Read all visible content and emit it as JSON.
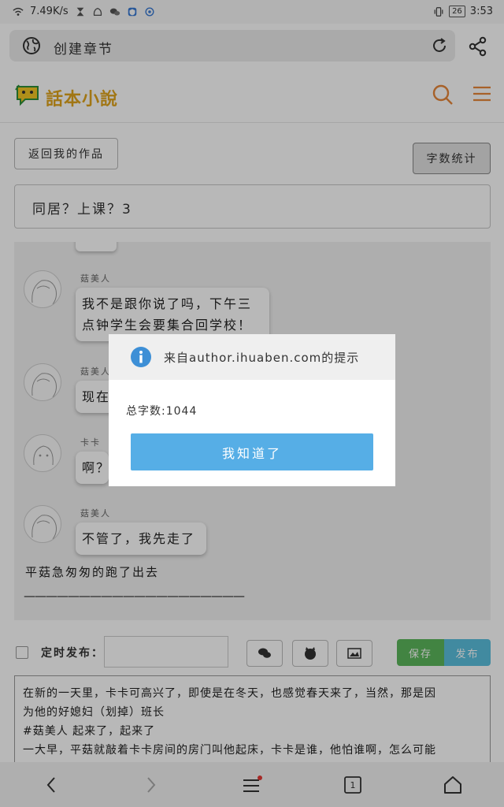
{
  "status_bar": {
    "speed": "7.49K/s",
    "battery": "26",
    "time": "3:53"
  },
  "browser": {
    "address_text": "创建章节"
  },
  "site": {
    "logo_text": "話本小說"
  },
  "toolbar": {
    "back_label": "返回我的作品",
    "count_label": "字数统计"
  },
  "chapter": {
    "title": "同居？上课？3"
  },
  "preview": {
    "messages": [
      {
        "name": "菇美人",
        "lines": [
          "我不是跟你说了吗，下午三",
          "点钟学生会要集合回学校！"
        ]
      },
      {
        "name": "菇美人",
        "lines": [
          "现在"
        ]
      },
      {
        "name": "卡卡",
        "lines": [
          "啊？"
        ]
      },
      {
        "name": "菇美人",
        "lines": [
          "不管了，我先走了"
        ]
      }
    ],
    "narration": "平菇急匆匆的跑了出去",
    "dashes": "————————————————————"
  },
  "publish": {
    "schedule_label": "定时发布：",
    "save_label": "保存",
    "publish_label": "发布"
  },
  "editor": {
    "lines": [
      "在新的一天里，卡卡可高兴了，即使是在冬天，也感觉春天来了，当然，那是因",
      "为他的好媳妇（划掉）班长",
      "#菇美人 起来了，起来了",
      "一大早，平菇就敲着卡卡房间的房门叫他起床，卡卡是谁，他怕谁啊，怎么可能"
    ]
  },
  "dialog": {
    "title": "来自author.ihuaben.com的提示",
    "body": "总字数:1044",
    "ok_label": "我知道了"
  },
  "colors": {
    "accent_orange": "#e8873a",
    "save_green": "#5cb85c",
    "publish_blue": "#5bc0de",
    "dialog_button": "#56aee6",
    "info_icon": "#3d8fd6"
  },
  "icons": {
    "status_left": [
      "wifi-icon",
      "hourglass-icon",
      "app-icon",
      "wechat-icon",
      "shield-icon",
      "browser-icon"
    ],
    "status_right": [
      "vibrate-icon",
      "battery-icon"
    ],
    "nav": [
      "back-arrow-icon",
      "forward-arrow-icon",
      "menu-icon",
      "tabs-icon",
      "home-icon"
    ]
  },
  "nav": {
    "tabs_count": "1"
  }
}
